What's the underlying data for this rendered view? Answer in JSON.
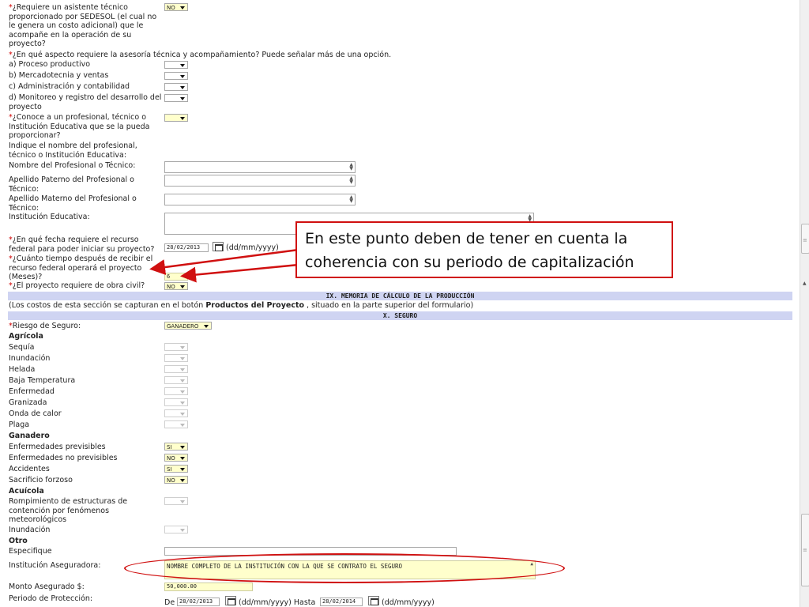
{
  "form": {
    "q_asistente": "¿Requiere un asistente técnico proporcionado por SEDESOL (el cual no le genera un costo adicional) que le acompañe en la operación de su proyecto?",
    "q_asistente_val": "NO",
    "q_aspecto": "¿En qué aspecto requiere la asesoría técnica y acompañamiento? Puede señalar más de una opción.",
    "opt_a": "a) Proceso productivo",
    "opt_b": "b) Mercadotecnia y ventas",
    "opt_c": "c) Administración y contabilidad",
    "opt_d": "d) Monitoreo y registro del desarrollo del proyecto",
    "q_conoce": "¿Conoce a un profesional, técnico o Institución Educativa que se la pueda proporcionar?",
    "indique": "Indique el nombre del profesional, técnico o Institución Educativa:",
    "nombre_prof": "Nombre del Profesional o Técnico:",
    "apellido_pat": "Apellido Paterno del Profesional o Técnico:",
    "apellido_mat": "Apellido Materno del Profesional o Técnico:",
    "institucion_edu": "Institución Educativa:",
    "q_fecha": "¿En qué fecha requiere el recurso federal para poder iniciar su proyecto?",
    "fecha_val": "28/02/2013",
    "date_hint": "(dd/mm/yyyy)",
    "q_tiempo": "¿Cuánto tiempo después de recibir el recurso federal operará el proyecto (Meses)?",
    "tiempo_val": "6",
    "q_obra": "¿El proyecto requiere de obra civil?",
    "obra_val": "NO"
  },
  "sections": {
    "memoria_title": "IX. MEMORIA DE CÁLCULO DE LA PRODUCCIÓN",
    "memoria_note_a": "(Los costos de esta sección se capturan en el botón ",
    "memoria_note_bold": "Productos del Proyecto",
    "memoria_note_b": " , situado en la parte superior del formulario)",
    "seguro_title": "X. SEGURO"
  },
  "seguro": {
    "riesgo": "Riesgo de Seguro:",
    "riesgo_val": "GANADERO",
    "agricola": "Agrícola",
    "agricola_items": [
      "Sequía",
      "Inundación",
      "Helada",
      "Baja Temperatura",
      "Enfermedad",
      "Granizada",
      "Onda de calor",
      "Plaga"
    ],
    "ganadero": "Ganadero",
    "ganadero_items": [
      "Enfermedades previsibles",
      "Enfermedades no previsibles",
      "Accidentes",
      "Sacrificio forzoso"
    ],
    "ganadero_vals": [
      "SI",
      "NO",
      "SI",
      "NO"
    ],
    "acuicola": "Acuícola",
    "acuicola_item1": "Rompimiento de estructuras de contención por fenómenos meteorológicos",
    "acuicola_item2": "Inundación",
    "otro": "Otro",
    "especifique": "Especifique",
    "aseguradora": "Institución Aseguradora:",
    "aseguradora_val": "NOMBRE COMPLETO DE LA INSTITUCIÓN CON LA QUE SE CONTRATO EL SEGURO",
    "monto": "Monto Asegurado $:",
    "monto_val": "50,000.00",
    "periodo": "Periodo de Protección:",
    "de": "De",
    "de_val": "28/02/2013",
    "hasta": "(dd/mm/yyyy) Hasta",
    "hasta_val": "28/02/2014",
    "hint_end": "(dd/mm/yyyy)"
  },
  "annotation": {
    "callout": "En este punto deben de tener en cuenta la coherencia con su periodo de capitalización",
    "color": "#d01010"
  }
}
